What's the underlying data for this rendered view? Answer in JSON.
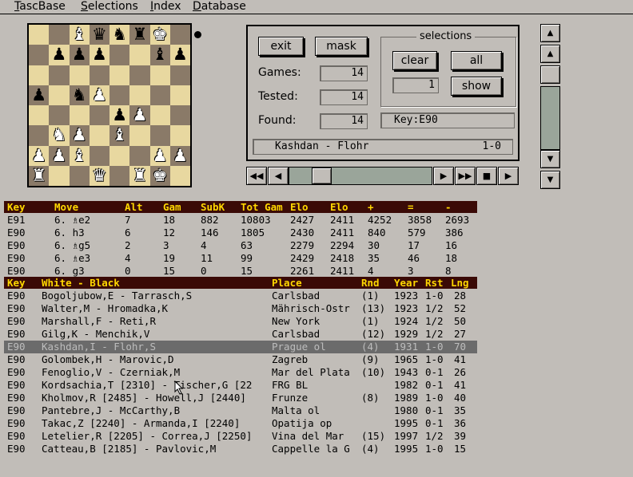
{
  "menu": [
    "TascBase",
    "Selections",
    "Index",
    "Database"
  ],
  "board": {
    "squares": [
      [
        "",
        "",
        "wB",
        "bQ",
        "bN",
        "bR",
        "wK",
        ""
      ],
      [
        "",
        "bP",
        "bP",
        "bP",
        "",
        "",
        "bB",
        "bP"
      ],
      [
        "",
        "",
        "",
        "",
        "",
        "",
        "",
        ""
      ],
      [
        "bP",
        "",
        "bN",
        "wP",
        "",
        "",
        "",
        ""
      ],
      [
        "",
        "",
        "",
        "",
        "bP",
        "wP",
        "",
        ""
      ],
      [
        "",
        "wN",
        "wP",
        "",
        "wB",
        "",
        "",
        ""
      ],
      [
        "wP",
        "wP",
        "wB",
        "",
        "",
        "",
        "wP",
        "wP"
      ],
      [
        "wR",
        "",
        "",
        "wQ",
        "",
        "wR",
        "wK",
        ""
      ]
    ],
    "light_color": "#e8d8a0",
    "dark_color": "#8a7a68"
  },
  "panel": {
    "exit_label": "exit",
    "mask_label": "mask",
    "games_label": "Games:",
    "games_value": "14",
    "tested_label": "Tested:",
    "tested_value": "14",
    "found_label": "Found:",
    "found_value": "14",
    "key_field": "Key:E90",
    "game_players": "Kashdan - Flohr",
    "game_result": "1-0",
    "selections": {
      "title": "selections",
      "clear_label": "clear",
      "all_label": "all",
      "count_value": "1",
      "show_label": "show"
    }
  },
  "nav": {
    "first_icon": "rewind-icon",
    "prev_icon": "step-back-icon",
    "next_icon": "step-forward-icon",
    "fast_icon": "fast-forward-icon",
    "stop_icon": "stop-icon",
    "play_icon": "play-icon"
  },
  "moves_table": {
    "headers": [
      "Key",
      "Move",
      "Alt",
      "Gam",
      "SubK",
      "Tot Gam",
      "Elo",
      "Elo",
      "+",
      "=",
      "-"
    ],
    "rows": [
      [
        "E91",
        "6. ♗e2",
        "7",
        "18",
        "882",
        "10803",
        "2427",
        "2411",
        "4252",
        "3858",
        "2693"
      ],
      [
        "E90",
        "6. h3",
        "6",
        "12",
        "146",
        "1805",
        "2430",
        "2411",
        "840",
        "579",
        "386"
      ],
      [
        "E90",
        "6. ♗g5",
        "2",
        "3",
        "4",
        "63",
        "2279",
        "2294",
        "30",
        "17",
        "16"
      ],
      [
        "E90",
        "6. ♗e3",
        "4",
        "19",
        "11",
        "99",
        "2429",
        "2418",
        "35",
        "46",
        "18"
      ],
      [
        "E90",
        "6. g3",
        "0",
        "15",
        "0",
        "15",
        "2261",
        "2411",
        "4",
        "3",
        "8"
      ]
    ]
  },
  "games_table": {
    "headers": [
      "Key",
      "White - Black",
      "Place",
      "Rnd",
      "Year",
      "Rst",
      "Lng"
    ],
    "selected_index": 4,
    "rows": [
      [
        "E90",
        "Bogoljubow,E - Tarrasch,S",
        "Carlsbad",
        "(1)",
        "1923",
        "1-0",
        "28"
      ],
      [
        "E90",
        "Walter,M - Hromadka,K",
        "Mährisch-Ostr",
        "(13)",
        "1923",
        "1/2",
        "52"
      ],
      [
        "E90",
        "Marshall,F - Reti,R",
        "New York",
        "(1)",
        "1924",
        "1/2",
        "50"
      ],
      [
        "E90",
        "Gilg,K - Menchik,V",
        "Carlsbad",
        "(12)",
        "1929",
        "1/2",
        "27"
      ],
      [
        "E90",
        "Kashdan,I - Flohr,S",
        "Prague ol",
        "(4)",
        "1931",
        "1-0",
        "70"
      ],
      [
        "E90",
        "Golombek,H - Marovic,D",
        "Zagreb",
        "(9)",
        "1965",
        "1-0",
        "41"
      ],
      [
        "E90",
        "Fenoglio,V - Czerniak,M",
        "Mar del Plata",
        "(10)",
        "1943",
        "0-1",
        "26"
      ],
      [
        "E90",
        "Kordsachia,T [2310] - Tischer,G [22",
        "FRG BL",
        "",
        "1982",
        "0-1",
        "41"
      ],
      [
        "E90",
        "Kholmov,R [2485] - Howell,J [2440]",
        "Frunze",
        "(8)",
        "1989",
        "1-0",
        "40"
      ],
      [
        "E90",
        "Pantebre,J - McCarthy,B",
        "Malta ol",
        "",
        "1980",
        "0-1",
        "35"
      ],
      [
        "E90",
        "Takac,Z [2240] - Armanda,I [2240]",
        "Opatija op",
        "",
        "1995",
        "0-1",
        "36"
      ],
      [
        "E90",
        "Letelier,R [2205] - Correa,J [2250]",
        "Vina del Mar",
        "(15)",
        "1997",
        "1/2",
        "39"
      ],
      [
        "E90",
        "Catteau,B [2185] - Pavlovic,M",
        "Cappelle la G",
        "(4)",
        "1995",
        "1-0",
        "15"
      ]
    ]
  },
  "colors": {
    "header_bg": "#3a0a06",
    "header_text": "#ffd700",
    "background": "#c1bdb8",
    "selected_row": "#6b6b6b"
  }
}
